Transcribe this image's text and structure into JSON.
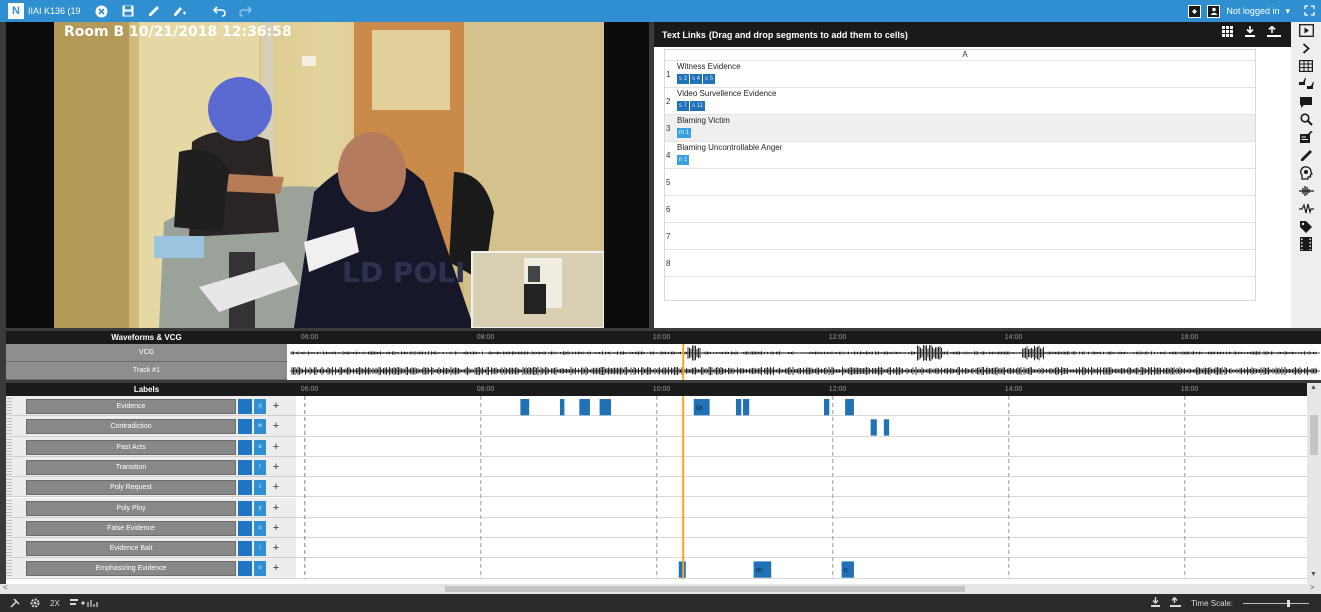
{
  "topbar": {
    "logo": "N",
    "title": "IIAI K136 (19",
    "buttons": [
      "close-circle",
      "save",
      "pen",
      "highlighter",
      "undo",
      "redo"
    ],
    "login_label": "Not logged in",
    "login_caret": "▾"
  },
  "video": {
    "timestamp": "Room B 10/21/2018 12:36:58",
    "watermark": "LD POLI"
  },
  "text_links": {
    "title": "Text Links",
    "subtitle": "(Drag and drop segments to add them to cells)",
    "column_header": "A",
    "rows": [
      {
        "num": "1",
        "label": "Witness Evidence",
        "chips": [
          "s 3",
          "s 4",
          "s 5"
        ],
        "light": false
      },
      {
        "num": "2",
        "label": "Video Survellence Evidence",
        "chips": [
          "s 7",
          "s 11"
        ],
        "light": false
      },
      {
        "num": "3",
        "label": "Blaming Victim",
        "chips": [
          "m 1"
        ],
        "light": true
      },
      {
        "num": "4",
        "label": "Blaming Uncontrollable Anger",
        "chips": [
          "n 1"
        ],
        "light": true
      },
      {
        "num": "5",
        "label": "",
        "chips": [],
        "light": false
      },
      {
        "num": "6",
        "label": "",
        "chips": [],
        "light": false
      },
      {
        "num": "7",
        "label": "",
        "chips": [],
        "light": false
      },
      {
        "num": "8",
        "label": "",
        "chips": [],
        "light": false
      }
    ]
  },
  "rail_icons": [
    "video-icon",
    "chevron-right-icon",
    "table-icon",
    "thumbs-icon",
    "comment-icon",
    "search-icon",
    "edit-document-icon",
    "pen-icon",
    "head-icon",
    "waveform-icon",
    "waveform-alt-icon",
    "tag-icon",
    "film-icon"
  ],
  "waveforms": {
    "header": "Waveforms & VCG",
    "tracks": [
      "VCG",
      "Track #1"
    ],
    "ticks": [
      "06:00",
      "08:00",
      "10:00",
      "12:00",
      "14:00",
      "16:00"
    ]
  },
  "labels": {
    "header": "Labels",
    "rows": [
      {
        "name": "Evidence",
        "key": "q"
      },
      {
        "name": "Contradiction",
        "key": "w"
      },
      {
        "name": "Past Acts",
        "key": "e"
      },
      {
        "name": "Transition",
        "key": "r"
      },
      {
        "name": "Poly Request",
        "key": "t"
      },
      {
        "name": "Poly Ploy",
        "key": "y"
      },
      {
        "name": "False Evidence",
        "key": "u"
      },
      {
        "name": "Evidence Bait",
        "key": "i"
      },
      {
        "name": "Emphasizing Evidence",
        "key": "o"
      }
    ],
    "plus": "+"
  },
  "timeline": {
    "start_min": 5.9,
    "end_min": 17.4,
    "playhead_min": 10.3,
    "segments": [
      {
        "row": 0,
        "start": 8.45,
        "end": 8.55,
        "label": ""
      },
      {
        "row": 0,
        "start": 8.9,
        "end": 8.95,
        "label": ""
      },
      {
        "row": 0,
        "start": 9.12,
        "end": 9.24,
        "label": ""
      },
      {
        "row": 0,
        "start": 9.35,
        "end": 9.48,
        "label": ""
      },
      {
        "row": 0,
        "start": 10.42,
        "end": 10.6,
        "label": "06"
      },
      {
        "row": 0,
        "start": 10.9,
        "end": 10.96,
        "label": ""
      },
      {
        "row": 0,
        "start": 10.98,
        "end": 11.05,
        "label": ""
      },
      {
        "row": 0,
        "start": 11.9,
        "end": 11.96,
        "label": ""
      },
      {
        "row": 0,
        "start": 12.14,
        "end": 12.24,
        "label": ""
      },
      {
        "row": 1,
        "start": 12.43,
        "end": 12.5,
        "label": ""
      },
      {
        "row": 1,
        "start": 12.58,
        "end": 12.64,
        "label": ""
      },
      {
        "row": 8,
        "start": 10.25,
        "end": 10.33,
        "label": ""
      },
      {
        "row": 8,
        "start": 11.1,
        "end": 11.3,
        "label": "00:"
      },
      {
        "row": 8,
        "start": 12.1,
        "end": 12.24,
        "label": "0:"
      }
    ]
  },
  "bottombar": {
    "speed": "2X",
    "time_scale_label": "Time Scale:"
  },
  "colors": {
    "accent": "#2f8fd0",
    "segment": "#2071b5",
    "playhead": "#f5a623"
  }
}
